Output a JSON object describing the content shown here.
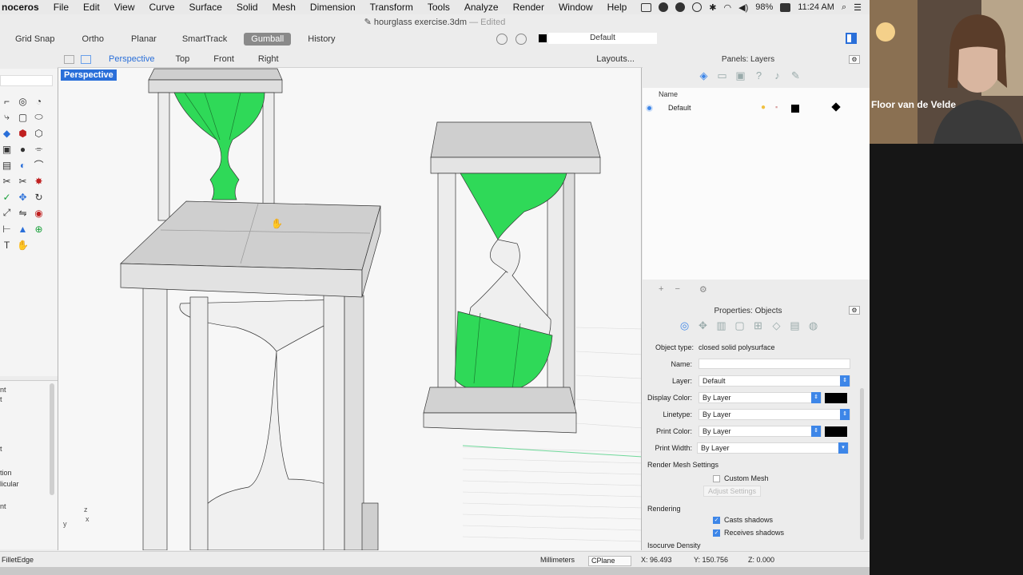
{
  "menubar": {
    "app_name": "noceros",
    "items": [
      "File",
      "Edit",
      "View",
      "Curve",
      "Surface",
      "Solid",
      "Mesh",
      "Dimension",
      "Transform",
      "Tools",
      "Analyze",
      "Render",
      "Window",
      "Help"
    ],
    "battery": "98%",
    "clock": "11:24 AM"
  },
  "window": {
    "title": "hourglass exercise.3dm",
    "status": "— Edited"
  },
  "toolbar": {
    "toggles": [
      "Grid Snap",
      "Ortho",
      "Planar",
      "SmartTrack",
      "Gumball",
      "History"
    ],
    "active_toggle": "Gumball",
    "current_layer": "Default"
  },
  "viewport_tabs": {
    "tabs": [
      "Perspective",
      "Top",
      "Front",
      "Right"
    ],
    "active": "Perspective",
    "layouts": "Layouts..."
  },
  "viewport": {
    "label": "Perspective",
    "axis_z": "z",
    "axis_y": "y",
    "axis_x": "x"
  },
  "history_panel": {
    "fragments": [
      "nt",
      "t",
      "t",
      "tion",
      "licular",
      "nt"
    ]
  },
  "layers_panel": {
    "title": "Panels: Layers",
    "column": "Name",
    "layers": [
      {
        "name": "Default",
        "color": "#000000"
      }
    ]
  },
  "properties_panel": {
    "title": "Properties: Objects",
    "object_type_label": "Object type:",
    "object_type": "closed solid polysurface",
    "name_label": "Name:",
    "name_value": "",
    "layer_label": "Layer:",
    "layer_value": "Default",
    "display_color_label": "Display Color:",
    "display_color_value": "By Layer",
    "linetype_label": "Linetype:",
    "linetype_value": "By Layer",
    "print_color_label": "Print Color:",
    "print_color_value": "By Layer",
    "print_width_label": "Print Width:",
    "print_width_value": "By Layer",
    "render_mesh_section": "Render Mesh Settings",
    "custom_mesh_label": "Custom Mesh",
    "custom_mesh_checked": false,
    "adjust_settings": "Adjust Settings",
    "rendering_section": "Rendering",
    "casts_shadows_label": "Casts shadows",
    "casts_shadows_checked": true,
    "receives_shadows_label": "Receives shadows",
    "receives_shadows_checked": true,
    "isocurve_section": "Isocurve Density"
  },
  "statusbar": {
    "command": "FilletEdge",
    "units": "Millimeters",
    "cplane": "CPlane",
    "x": "X: 96.493",
    "y": "Y: 150.756",
    "z": "Z: 0.000"
  },
  "webcam": {
    "name": "Floor van de Velde"
  },
  "colors": {
    "accent": "#2a6fd9",
    "model_green": "#2fd958",
    "model_gray": "#d6d6d6"
  }
}
